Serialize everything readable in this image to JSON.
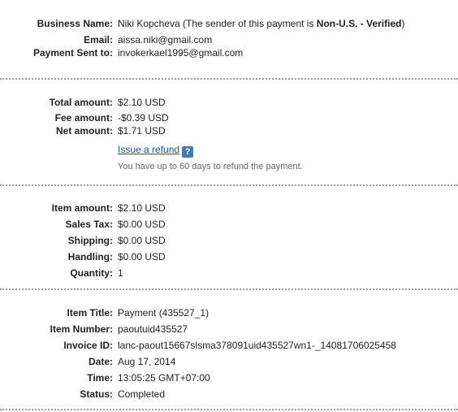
{
  "business": {
    "name_label": "Business Name:",
    "name_value_prefix": "Niki Kopcheva (The sender of this payment is ",
    "name_value_status": "Non-U.S. - Verified",
    "name_value_suffix": ")",
    "email_label": "Email:",
    "email_value": "aissa.niki@gmail.com",
    "sent_to_label": "Payment Sent to:",
    "sent_to_value": "invokerkael1995@gmail.com"
  },
  "amounts": {
    "total_label": "Total amount:",
    "total_value": "$2.10 USD",
    "fee_label": "Fee amount:",
    "fee_value": "-$0.39 USD",
    "net_label": "Net amount:",
    "net_value": "$1.71 USD",
    "refund_link": "Issue a refund",
    "help_icon_glyph": "?",
    "refund_note": "You have up to 60 days to refund the payment."
  },
  "items": {
    "item_amount_label": "Item amount:",
    "item_amount_value": "$2.10 USD",
    "sales_tax_label": "Sales Tax:",
    "sales_tax_value": "$0.00 USD",
    "shipping_label": "Shipping:",
    "shipping_value": "$0.00 USD",
    "handling_label": "Handling:",
    "handling_value": "$0.00 USD",
    "quantity_label": "Quantity:",
    "quantity_value": "1"
  },
  "details": {
    "title_label": "Item Title:",
    "title_value": "Payment (435527_1)",
    "number_label": "Item Number:",
    "number_value": "paoutuid435527",
    "invoice_label": "Invoice ID:",
    "invoice_value": "lanc-paout15667slsma378091uid435527wn1-_14081706025458",
    "date_label": "Date:",
    "date_value": "Aug 17, 2014",
    "time_label": "Time:",
    "time_value": "13:05:25 GMT+07:00",
    "status_label": "Status:",
    "status_value": "Completed"
  },
  "colors": {
    "link": "#0a5da5",
    "help_icon_bg": "#3c7fb7",
    "separator": "#9a9a9a",
    "note_text": "#666666"
  }
}
